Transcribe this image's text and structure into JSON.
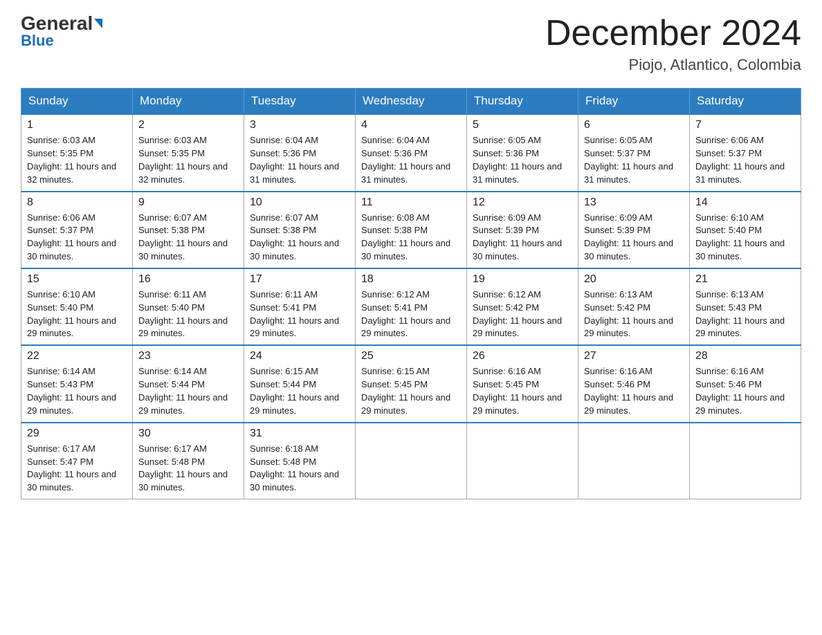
{
  "header": {
    "logo_top": "General",
    "logo_bottom": "Blue",
    "month_title": "December 2024",
    "location": "Piojo, Atlantico, Colombia"
  },
  "weekdays": [
    "Sunday",
    "Monday",
    "Tuesday",
    "Wednesday",
    "Thursday",
    "Friday",
    "Saturday"
  ],
  "weeks": [
    [
      {
        "num": "1",
        "sunrise": "6:03 AM",
        "sunset": "5:35 PM",
        "daylight": "11 hours and 32 minutes."
      },
      {
        "num": "2",
        "sunrise": "6:03 AM",
        "sunset": "5:35 PM",
        "daylight": "11 hours and 32 minutes."
      },
      {
        "num": "3",
        "sunrise": "6:04 AM",
        "sunset": "5:36 PM",
        "daylight": "11 hours and 31 minutes."
      },
      {
        "num": "4",
        "sunrise": "6:04 AM",
        "sunset": "5:36 PM",
        "daylight": "11 hours and 31 minutes."
      },
      {
        "num": "5",
        "sunrise": "6:05 AM",
        "sunset": "5:36 PM",
        "daylight": "11 hours and 31 minutes."
      },
      {
        "num": "6",
        "sunrise": "6:05 AM",
        "sunset": "5:37 PM",
        "daylight": "11 hours and 31 minutes."
      },
      {
        "num": "7",
        "sunrise": "6:06 AM",
        "sunset": "5:37 PM",
        "daylight": "11 hours and 31 minutes."
      }
    ],
    [
      {
        "num": "8",
        "sunrise": "6:06 AM",
        "sunset": "5:37 PM",
        "daylight": "11 hours and 30 minutes."
      },
      {
        "num": "9",
        "sunrise": "6:07 AM",
        "sunset": "5:38 PM",
        "daylight": "11 hours and 30 minutes."
      },
      {
        "num": "10",
        "sunrise": "6:07 AM",
        "sunset": "5:38 PM",
        "daylight": "11 hours and 30 minutes."
      },
      {
        "num": "11",
        "sunrise": "6:08 AM",
        "sunset": "5:38 PM",
        "daylight": "11 hours and 30 minutes."
      },
      {
        "num": "12",
        "sunrise": "6:09 AM",
        "sunset": "5:39 PM",
        "daylight": "11 hours and 30 minutes."
      },
      {
        "num": "13",
        "sunrise": "6:09 AM",
        "sunset": "5:39 PM",
        "daylight": "11 hours and 30 minutes."
      },
      {
        "num": "14",
        "sunrise": "6:10 AM",
        "sunset": "5:40 PM",
        "daylight": "11 hours and 30 minutes."
      }
    ],
    [
      {
        "num": "15",
        "sunrise": "6:10 AM",
        "sunset": "5:40 PM",
        "daylight": "11 hours and 29 minutes."
      },
      {
        "num": "16",
        "sunrise": "6:11 AM",
        "sunset": "5:40 PM",
        "daylight": "11 hours and 29 minutes."
      },
      {
        "num": "17",
        "sunrise": "6:11 AM",
        "sunset": "5:41 PM",
        "daylight": "11 hours and 29 minutes."
      },
      {
        "num": "18",
        "sunrise": "6:12 AM",
        "sunset": "5:41 PM",
        "daylight": "11 hours and 29 minutes."
      },
      {
        "num": "19",
        "sunrise": "6:12 AM",
        "sunset": "5:42 PM",
        "daylight": "11 hours and 29 minutes."
      },
      {
        "num": "20",
        "sunrise": "6:13 AM",
        "sunset": "5:42 PM",
        "daylight": "11 hours and 29 minutes."
      },
      {
        "num": "21",
        "sunrise": "6:13 AM",
        "sunset": "5:43 PM",
        "daylight": "11 hours and 29 minutes."
      }
    ],
    [
      {
        "num": "22",
        "sunrise": "6:14 AM",
        "sunset": "5:43 PM",
        "daylight": "11 hours and 29 minutes."
      },
      {
        "num": "23",
        "sunrise": "6:14 AM",
        "sunset": "5:44 PM",
        "daylight": "11 hours and 29 minutes."
      },
      {
        "num": "24",
        "sunrise": "6:15 AM",
        "sunset": "5:44 PM",
        "daylight": "11 hours and 29 minutes."
      },
      {
        "num": "25",
        "sunrise": "6:15 AM",
        "sunset": "5:45 PM",
        "daylight": "11 hours and 29 minutes."
      },
      {
        "num": "26",
        "sunrise": "6:16 AM",
        "sunset": "5:45 PM",
        "daylight": "11 hours and 29 minutes."
      },
      {
        "num": "27",
        "sunrise": "6:16 AM",
        "sunset": "5:46 PM",
        "daylight": "11 hours and 29 minutes."
      },
      {
        "num": "28",
        "sunrise": "6:16 AM",
        "sunset": "5:46 PM",
        "daylight": "11 hours and 29 minutes."
      }
    ],
    [
      {
        "num": "29",
        "sunrise": "6:17 AM",
        "sunset": "5:47 PM",
        "daylight": "11 hours and 30 minutes."
      },
      {
        "num": "30",
        "sunrise": "6:17 AM",
        "sunset": "5:48 PM",
        "daylight": "11 hours and 30 minutes."
      },
      {
        "num": "31",
        "sunrise": "6:18 AM",
        "sunset": "5:48 PM",
        "daylight": "11 hours and 30 minutes."
      },
      null,
      null,
      null,
      null
    ]
  ]
}
